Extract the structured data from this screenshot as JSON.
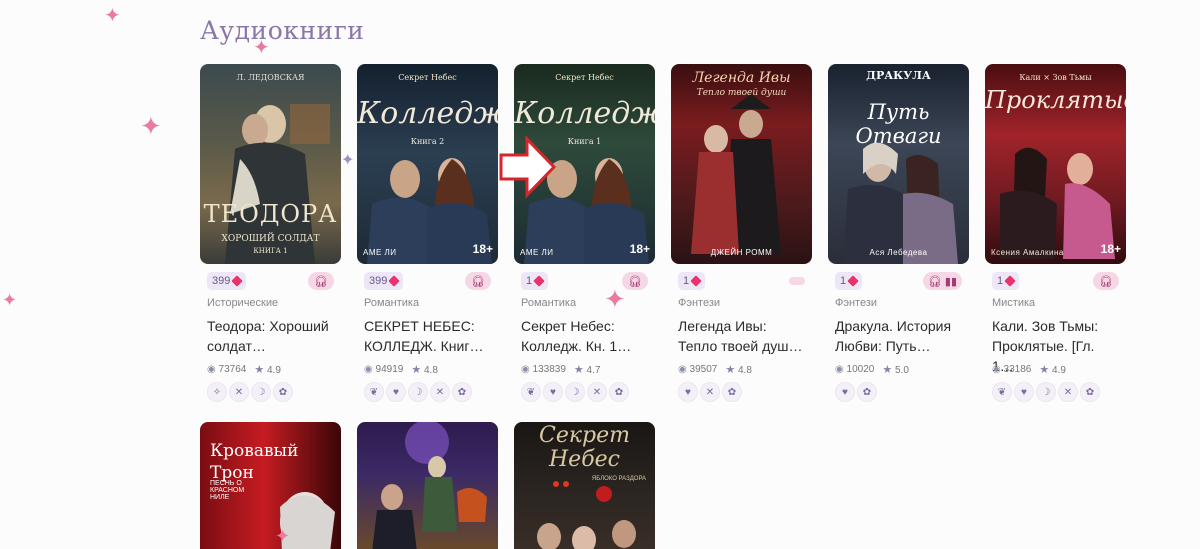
{
  "section": {
    "title": "Аудиокниги"
  },
  "books": [
    {
      "cover_top": "Л. ЛЕДОВСКАЯ",
      "cover_title": "ТЕОДОРА",
      "cover_sub": "ХОРОШИЙ СОЛДАТ",
      "cover_book": "КНИГА 1",
      "cover_author": "",
      "age": "",
      "price": "399",
      "genre": "Исторические",
      "title": "Теодора: Хороший солдат…",
      "views": "73764",
      "rating": "4.9",
      "formats": [
        "headphones"
      ],
      "tags": [
        "✧",
        "✕",
        "☽",
        "✿"
      ]
    },
    {
      "cover_top": "Секрет Небес",
      "cover_title": "Колледж",
      "cover_sub": "Книга 2",
      "cover_book": "",
      "cover_author": "АМЕ ЛИ",
      "age": "18+",
      "price": "399",
      "genre": "Романтика",
      "title": "СЕКРЕТ НЕБЕС: КОЛЛЕДЖ. Книг…",
      "views": "94919",
      "rating": "4.8",
      "formats": [
        "headphones"
      ],
      "tags": [
        "❦",
        "♥",
        "☽",
        "✕",
        "✿"
      ]
    },
    {
      "cover_top": "Секрет Небес",
      "cover_title": "Колледж",
      "cover_sub": "Книга 1",
      "cover_book": "",
      "cover_author": "АМЕ ЛИ",
      "age": "18+",
      "price": "1",
      "genre": "Романтика",
      "title": "Секрет Небес: Колледж. Кн. 1…",
      "views": "133839",
      "rating": "4.7",
      "formats": [
        "headphones"
      ],
      "tags": [
        "❦",
        "♥",
        "☽",
        "✕",
        "✿"
      ]
    },
    {
      "cover_top": "Легенда Ивы",
      "cover_title": "",
      "cover_sub": "Тепло твоей души",
      "cover_book": "",
      "cover_author": "ДЖЕЙН РОММ",
      "age": "",
      "price": "1",
      "genre": "Фэнтези",
      "title": "Легенда Ивы: Тепло твоей душ…",
      "views": "39507",
      "rating": "4.8",
      "formats": [],
      "tags": [
        "♥",
        "✕",
        "✿"
      ]
    },
    {
      "cover_top": "ДРАКУЛА",
      "cover_title": "Путь Отваги",
      "cover_sub": "",
      "cover_book": "",
      "cover_author": "Ася Лебедева",
      "age": "",
      "price": "1",
      "genre": "Фэнтези",
      "title": "Дракула. История Любви: Путь…",
      "views": "10020",
      "rating": "5.0",
      "formats": [
        "headphones",
        "book"
      ],
      "tags": [
        "♥",
        "✿"
      ]
    },
    {
      "cover_top": "Кали × Зов Тьмы",
      "cover_title": "Проклятые",
      "cover_sub": "",
      "cover_book": "",
      "cover_author": "Ксения Амалкина",
      "age": "18+",
      "price": "1",
      "genre": "Мистика",
      "title": "Кали. Зов Тьмы: Проклятые. [Гл. 1…",
      "views": "33186",
      "rating": "4.9",
      "formats": [
        "headphones"
      ],
      "tags": [
        "❦",
        "♥",
        "☽",
        "✕",
        "✿"
      ]
    }
  ],
  "row2": [
    {
      "cover_title": "Кровавый Трон",
      "cover_sub": "ПЕСНЬ О КРАСНОМ НИЛЕ"
    },
    {
      "cover_title": "",
      "cover_sub": ""
    },
    {
      "cover_title": "Секрет Небес",
      "cover_sub": "ЯБЛОКО РАЗДОРА"
    }
  ],
  "colors": {
    "accent": "#8a76a8",
    "gem": "#e8336b",
    "format_bg": "#f6d7e6",
    "price_bg": "#ede6f6"
  }
}
